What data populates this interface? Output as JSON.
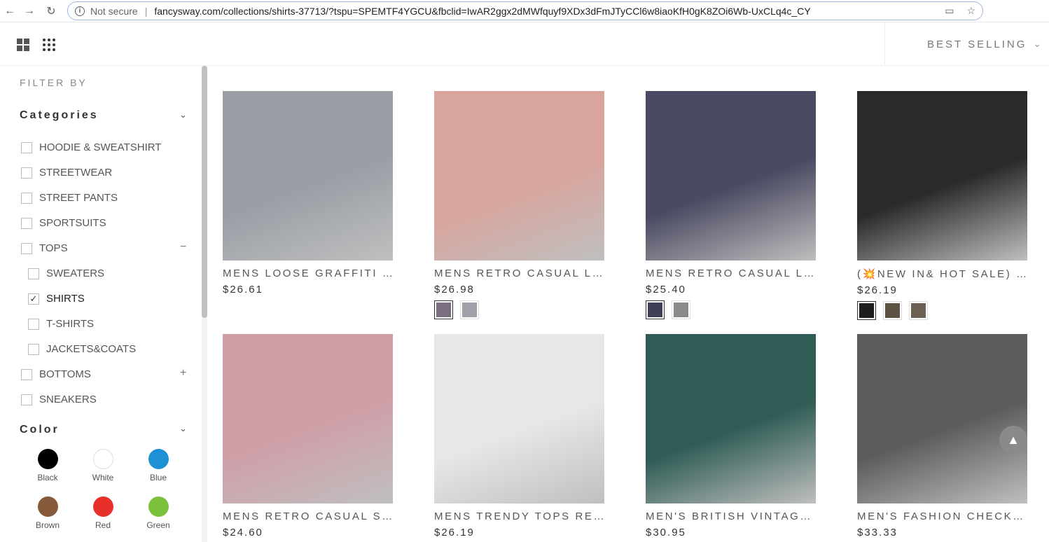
{
  "browser": {
    "secure_label": "Not secure",
    "url": "fancysway.com/collections/shirts-37713/?tspu=SPEMTF4YGCU&fbclid=IwAR2ggx2dMWfquyf9XDx3dFmJTyCCl6w8iaoKfH0gK8ZOi6Wb-UxCLq4c_CY"
  },
  "toolbar": {
    "sort_label": "BEST SELLING"
  },
  "sidebar": {
    "filter_title": "FILTER BY",
    "categories_title": "Categories",
    "categories": [
      {
        "label": "HOODIE & SWEATSHIRT"
      },
      {
        "label": "STREETWEAR"
      },
      {
        "label": "STREET PANTS"
      },
      {
        "label": "SPORTSUITS"
      },
      {
        "label": "TOPS",
        "toggle": "−"
      },
      {
        "label": "SWEATERS"
      },
      {
        "label": "SHIRTS",
        "checked": true
      },
      {
        "label": "T-SHIRTS"
      },
      {
        "label": "JACKETS&COATS"
      },
      {
        "label": "BOTTOMS",
        "toggle": "+"
      },
      {
        "label": "SNEAKERS"
      }
    ],
    "color_title": "Color",
    "colors": [
      {
        "label": "Black",
        "hex": "#000000"
      },
      {
        "label": "White",
        "hex": "#ffffff"
      },
      {
        "label": "Blue",
        "hex": "#1e90d4"
      },
      {
        "label": "Brown",
        "hex": "#86593a"
      },
      {
        "label": "Red",
        "hex": "#e8302a"
      },
      {
        "label": "Green",
        "hex": "#7cc13c"
      }
    ]
  },
  "products": [
    {
      "name": "MENS LOOSE GRAFFITI LOOSE SHIRT",
      "price": "$26.61",
      "bg": "#9a9fa6",
      "variants": []
    },
    {
      "name": "MENS RETRO CASUAL LOOSE SHIRT",
      "price": "$26.98",
      "bg": "#d9a49c",
      "variants": [
        "#7a6f7f",
        "#a0a0a8"
      ]
    },
    {
      "name": "MENS RETRO CASUAL LOOSE SHIRT",
      "price": "$25.40",
      "bg": "#4a4a62",
      "variants": [
        "#3f3f55",
        "#8d8a8c"
      ]
    },
    {
      "name": "(💥NEW IN& HOT SALE) MENS HOODED SHIRT",
      "price": "$26.19",
      "bg": "#2a2a2a",
      "variants": [
        "#1e1e1e",
        "#5b5242",
        "#6b6052"
      ]
    },
    {
      "name": "MENS RETRO CASUAL SHORT SLEEVE SHIRT",
      "price": "$24.60",
      "bg": "#cf9fa8",
      "variants": []
    },
    {
      "name": "MENS TRENDY TOPS RETRO SHIRT",
      "price": "$26.19",
      "bg": "#e9e7e5",
      "variants": []
    },
    {
      "name": "MEN'S BRITISH VINTAGE PLAID SHIRT",
      "price": "$30.95",
      "bg": "#2f5c55",
      "variants": []
    },
    {
      "name": "MEN'S FASHION CHECK HOODED SHIRT",
      "price": "$33.33",
      "bg": "#5c5c5e",
      "variants": []
    }
  ],
  "scroll_top_label": "▲"
}
